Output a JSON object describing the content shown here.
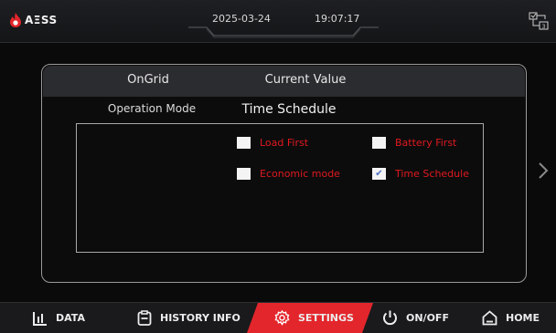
{
  "header": {
    "logo_text": "AΞSS",
    "date": "2025-03-24",
    "time": "19:07:17",
    "network_icon": "network-topology-icon"
  },
  "panel": {
    "col1_header": "OnGrid",
    "col2_header": "Current Value",
    "row": {
      "label": "Operation Mode",
      "value": "Time Schedule"
    },
    "options": [
      {
        "label": "Load First",
        "checked": false
      },
      {
        "label": "Battery First",
        "checked": false
      },
      {
        "label": "Economic mode",
        "checked": false
      },
      {
        "label": "Time Schedule",
        "checked": true
      }
    ],
    "check_mark": "✔"
  },
  "nav": {
    "items": [
      {
        "label": "DATA",
        "icon": "bar-chart-icon",
        "active": false
      },
      {
        "label": "HISTORY INFO",
        "icon": "clipboard-icon",
        "active": false
      },
      {
        "label": "SETTINGS",
        "icon": "gear-icon",
        "active": true
      },
      {
        "label": "ON/OFF",
        "icon": "power-icon",
        "active": false
      },
      {
        "label": "HOME",
        "icon": "home-icon",
        "active": false
      }
    ]
  },
  "colors": {
    "accent": "#e3262c",
    "option_text": "#e0191f",
    "background": "#0a0a0b"
  }
}
